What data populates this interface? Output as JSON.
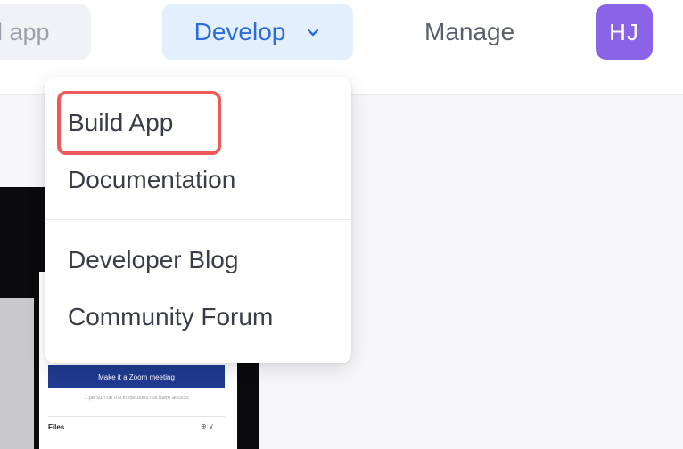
{
  "nav": {
    "search_text": "d app",
    "develop_label": "Develop",
    "manage_label": "Manage",
    "avatar_initials": "HJ"
  },
  "dropdown": {
    "items": [
      {
        "label": "Build App"
      },
      {
        "label": "Documentation"
      },
      {
        "label": "Developer Blog"
      },
      {
        "label": "Community Forum"
      }
    ],
    "highlighted_item": "Build App"
  },
  "background_thumbnail": {
    "banner_text": "Make it a Zoom meeting",
    "note_text": "1 person on the invite does not have access",
    "files_label": "Files",
    "icons_text": "⊕ ∨"
  },
  "colors": {
    "accent": "#2d6cdf",
    "develop_bg": "#e3effd",
    "avatar_bg": "#8b63e6",
    "highlight": "#ee5a5a"
  }
}
